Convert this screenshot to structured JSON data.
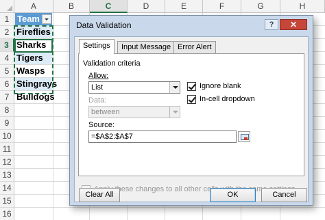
{
  "sheet": {
    "columns": [
      "A",
      "B",
      "C",
      "D",
      "E",
      "F",
      "G",
      "H"
    ],
    "selected_column": "C",
    "rows": [
      "1",
      "2",
      "3",
      "4",
      "5",
      "6",
      "7",
      "8",
      "9",
      "10",
      "11",
      "12",
      "13",
      "14",
      "15",
      "16"
    ],
    "selected_row": "3",
    "header_cell": "Team",
    "cells": [
      "Fireflies",
      "Sharks",
      "Tigers",
      "Wasps",
      "Stingrays",
      "Bulldogs"
    ],
    "colors": {
      "table_header": "#5b9bd5",
      "table_band": "#ddebf7",
      "accent": "#217346"
    }
  },
  "dialog": {
    "title": "Data Validation",
    "help_glyph": "?",
    "close_glyph": "✕",
    "tabs": [
      "Settings",
      "Input Message",
      "Error Alert"
    ],
    "active_tab": "Settings",
    "section_title": "Validation criteria",
    "allow_label": "Allow:",
    "allow_value": "List",
    "ignore_blank_label": "Ignore blank",
    "ignore_blank_checked": true,
    "in_cell_dropdown_label": "In-cell dropdown",
    "in_cell_dropdown_checked": true,
    "data_label": "Data:",
    "data_value": "between",
    "source_label": "Source:",
    "source_value": "=$A$2:$A$7",
    "apply_all_label": "Apply these changes to all other cells with the same settings",
    "apply_all_checked": false,
    "clear_all_label": "Clear All",
    "ok_label": "OK",
    "cancel_label": "Cancel"
  }
}
